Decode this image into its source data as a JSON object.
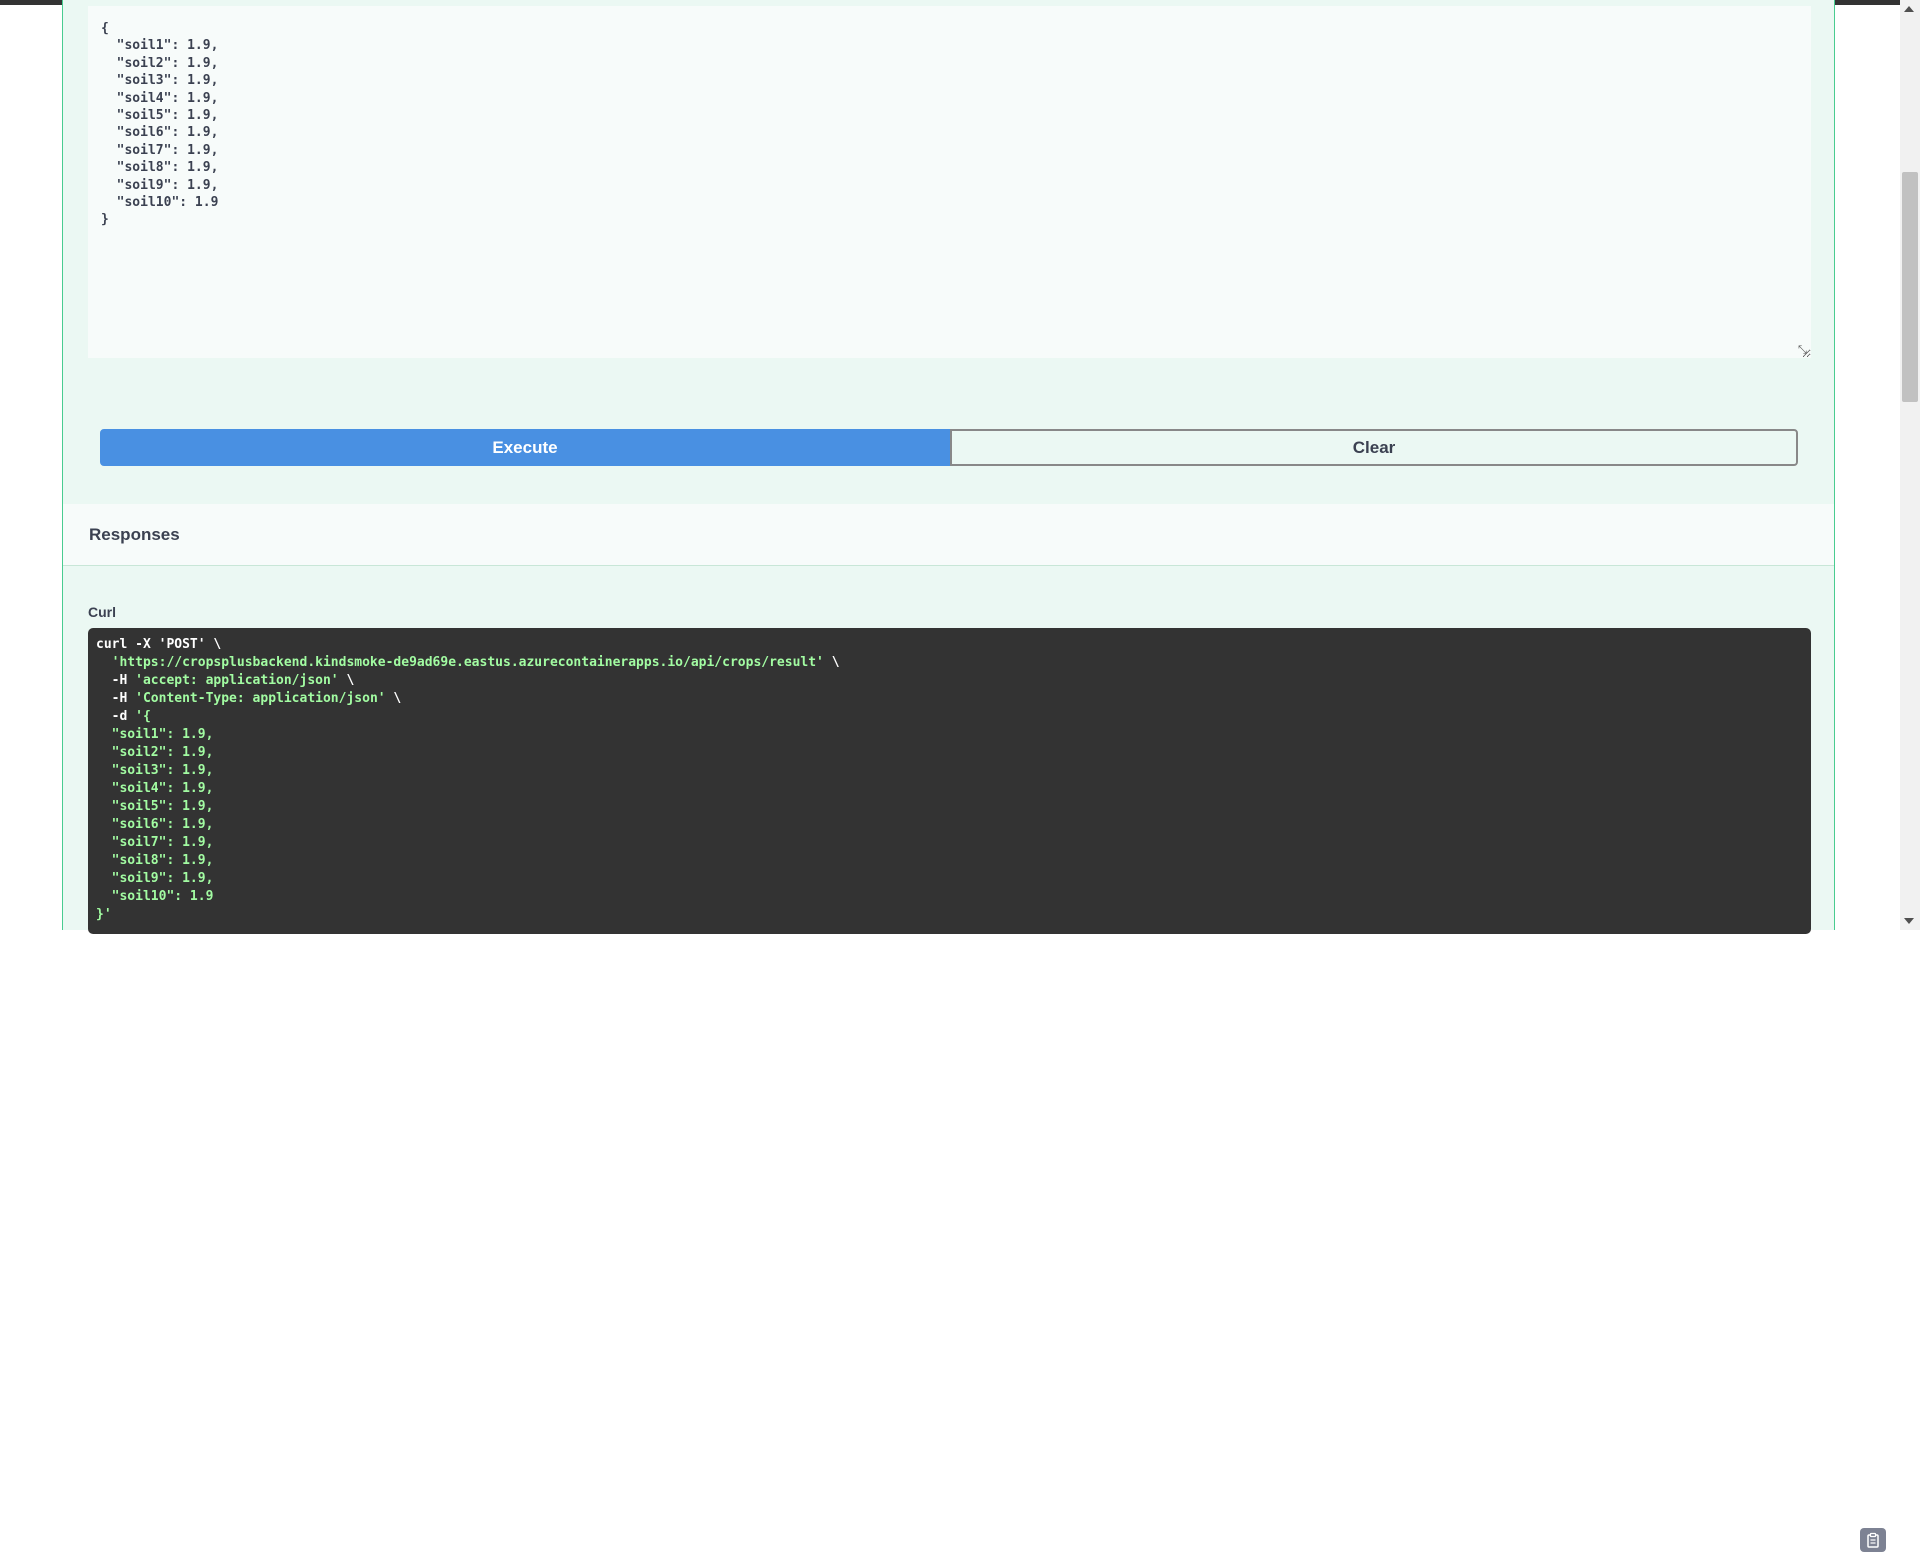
{
  "request_body": {
    "lines": [
      "{",
      "  \"soil1\": 1.9,",
      "  \"soil2\": 1.9,",
      "  \"soil3\": 1.9,",
      "  \"soil4\": 1.9,",
      "  \"soil5\": 1.9,",
      "  \"soil6\": 1.9,",
      "  \"soil7\": 1.9,",
      "  \"soil8\": 1.9,",
      "  \"soil9\": 1.9,",
      "  \"soil10\": 1.9",
      "}"
    ]
  },
  "buttons": {
    "execute_label": "Execute",
    "clear_label": "Clear"
  },
  "responses": {
    "title": "Responses"
  },
  "curl": {
    "label": "Curl",
    "command": "curl -X 'POST' \\",
    "url": "'https://cropsplusbackend.kindsmoke-de9ad69e.eastus.azurecontainerapps.io/api/crops/result'",
    "headers": [
      "-H 'accept: application/json'",
      "-H 'Content-Type: application/json'"
    ],
    "data_flag": "-d",
    "data_lines": [
      "'{",
      "  \"soil1\": 1.9,",
      "  \"soil2\": 1.9,",
      "  \"soil3\": 1.9,",
      "  \"soil4\": 1.9,",
      "  \"soil5\": 1.9,",
      "  \"soil6\": 1.9,",
      "  \"soil7\": 1.9,",
      "  \"soil8\": 1.9,",
      "  \"soil9\": 1.9,",
      "  \"soil10\": 1.9",
      "}'"
    ],
    "copy_icon": "clipboard-icon"
  },
  "colors": {
    "execute_bg": "#4990e2",
    "post_accent": "#49cc90",
    "block_bg": "#ebf8f3",
    "code_bg": "#333333",
    "string_color": "#a2fca2"
  }
}
